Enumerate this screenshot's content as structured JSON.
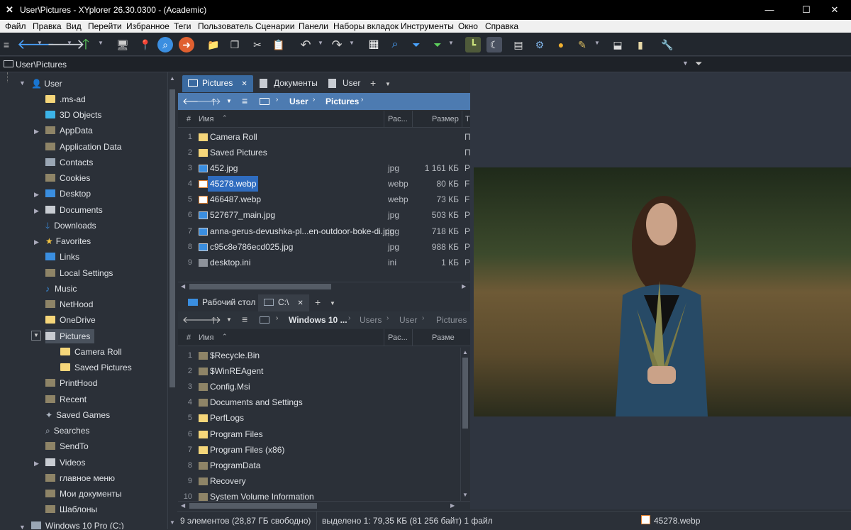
{
  "window": {
    "title": "User\\Pictures - XYplorer 26.30.0300 - (Academic)",
    "minimize": "—",
    "maximize": "☐",
    "close": "✕"
  },
  "menu": [
    "Файл",
    "Правка",
    "Вид",
    "Перейти",
    "Избранное",
    "Теги",
    "Пользователь",
    "Сценарии",
    "Панели",
    "Наборы вкладок",
    "Инструменты",
    "Окно",
    "Справка"
  ],
  "address": {
    "path": "User\\Pictures"
  },
  "tree": {
    "root": "User",
    "items": [
      {
        "label": ".ms-ad",
        "icon": "folder-icon"
      },
      {
        "label": "3D Objects",
        "icon": "cube-icon"
      },
      {
        "label": "AppData",
        "icon": "folder-icon"
      },
      {
        "label": "Application Data",
        "icon": "folder-link-icon"
      },
      {
        "label": "Contacts",
        "icon": "contacts-icon"
      },
      {
        "label": "Cookies",
        "icon": "folder-link-icon"
      },
      {
        "label": "Desktop",
        "icon": "desktop-icon"
      },
      {
        "label": "Documents",
        "icon": "documents-icon"
      },
      {
        "label": "Downloads",
        "icon": "download-icon"
      },
      {
        "label": "Favorites",
        "icon": "star-icon"
      },
      {
        "label": "Links",
        "icon": "links-icon"
      },
      {
        "label": "Local Settings",
        "icon": "folder-link-icon"
      },
      {
        "label": "Music",
        "icon": "music-icon"
      },
      {
        "label": "NetHood",
        "icon": "folder-link-icon"
      },
      {
        "label": "OneDrive",
        "icon": "folder-icon"
      },
      {
        "label": "Pictures",
        "icon": "pictures-icon"
      },
      {
        "label": "Camera Roll",
        "icon": "folder-icon"
      },
      {
        "label": "Saved Pictures",
        "icon": "folder-icon"
      },
      {
        "label": "PrintHood",
        "icon": "folder-link-icon"
      },
      {
        "label": "Recent",
        "icon": "folder-link-icon"
      },
      {
        "label": "Saved Games",
        "icon": "games-icon"
      },
      {
        "label": "Searches",
        "icon": "search-icon"
      },
      {
        "label": "SendTo",
        "icon": "folder-link-icon"
      },
      {
        "label": "Videos",
        "icon": "videos-icon"
      },
      {
        "label": "главное меню",
        "icon": "folder-link-icon"
      },
      {
        "label": "Мои документы",
        "icon": "folder-link-icon"
      },
      {
        "label": "Шаблоны",
        "icon": "folder-link-icon"
      }
    ],
    "drive": "Windows 10 Pro (C:)"
  },
  "pane1": {
    "tabs": [
      "Pictures",
      "Документы",
      "User"
    ],
    "crumbs": [
      "User",
      "Pictures"
    ],
    "columns": {
      "num": "#",
      "name": "Имя",
      "ext": "Рас...",
      "size": "Размер",
      "type": "Т"
    },
    "rows": [
      {
        "n": "1",
        "name": "Camera Roll",
        "ext": "",
        "size": "",
        "type": "П",
        "kind": "folder"
      },
      {
        "n": "2",
        "name": "Saved Pictures",
        "ext": "",
        "size": "",
        "type": "П",
        "kind": "folder"
      },
      {
        "n": "3",
        "name": "452.jpg",
        "ext": "jpg",
        "size": "1 161 КБ",
        "type": "Р",
        "kind": "image"
      },
      {
        "n": "4",
        "name": "45278.webp",
        "ext": "webp",
        "size": "80 КБ",
        "type": "F",
        "kind": "webp"
      },
      {
        "n": "5",
        "name": "466487.webp",
        "ext": "webp",
        "size": "73 КБ",
        "type": "F",
        "kind": "webp"
      },
      {
        "n": "6",
        "name": "527677_main.jpg",
        "ext": "jpg",
        "size": "503 КБ",
        "type": "Р",
        "kind": "image"
      },
      {
        "n": "7",
        "name": "anna-gerus-devushka-pl...en-outdoor-boke-di.jpg",
        "ext": "jpg",
        "size": "718 КБ",
        "type": "Р",
        "kind": "image"
      },
      {
        "n": "8",
        "name": "c95c8e786ecd025.jpg",
        "ext": "jpg",
        "size": "988 КБ",
        "type": "Р",
        "kind": "image"
      },
      {
        "n": "9",
        "name": "desktop.ini",
        "ext": "ini",
        "size": "1 КБ",
        "type": "Р",
        "kind": "ini"
      }
    ]
  },
  "pane2": {
    "tabs": [
      "Рабочий стол",
      "C:\\"
    ],
    "crumbs": [
      "Windows 10 ...",
      "Users",
      "User",
      "Pictures"
    ],
    "columns": {
      "num": "#",
      "name": "Имя",
      "ext": "Рас...",
      "size": "Разме"
    },
    "rows": [
      {
        "n": "1",
        "name": "$Recycle.Bin",
        "kind": "folder-link"
      },
      {
        "n": "2",
        "name": "$WinREAgent",
        "kind": "folder"
      },
      {
        "n": "3",
        "name": "Config.Msi",
        "kind": "folder-link"
      },
      {
        "n": "4",
        "name": "Documents and Settings",
        "kind": "folder-link"
      },
      {
        "n": "5",
        "name": "PerfLogs",
        "kind": "folder"
      },
      {
        "n": "6",
        "name": "Program Files",
        "kind": "folder"
      },
      {
        "n": "7",
        "name": "Program Files (x86)",
        "kind": "folder"
      },
      {
        "n": "8",
        "name": "ProgramData",
        "kind": "folder-link"
      },
      {
        "n": "9",
        "name": "Recovery",
        "kind": "folder-link"
      },
      {
        "n": "10",
        "name": "System Volume Information",
        "kind": "folder-link"
      }
    ]
  },
  "status": {
    "left": "9 элементов (28,87 ГБ свободно)",
    "middle": "выделено 1: 79,35 КБ (81 256 байт) 1 файл",
    "file": "45278.webp"
  },
  "colors": {
    "accent": "#4d7bb1",
    "selected": "#2f6cbf"
  }
}
